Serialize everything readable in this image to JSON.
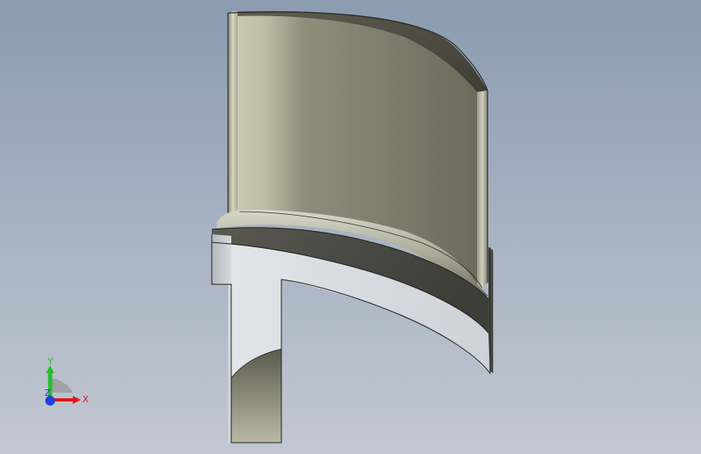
{
  "window": {
    "title": ""
  },
  "viewport": {
    "background_top": "#8b9bb0",
    "background_bottom": "#c2c8d2"
  },
  "model": {
    "name": "turbine-blade",
    "face_color": "#7a7a68",
    "section_color": "#d8dce2"
  },
  "triad": {
    "x_label": "X",
    "y_label": "Y",
    "z_label": "Z",
    "x_color": "#e01818",
    "y_color": "#22c022",
    "z_color": "#1f3fe0"
  }
}
